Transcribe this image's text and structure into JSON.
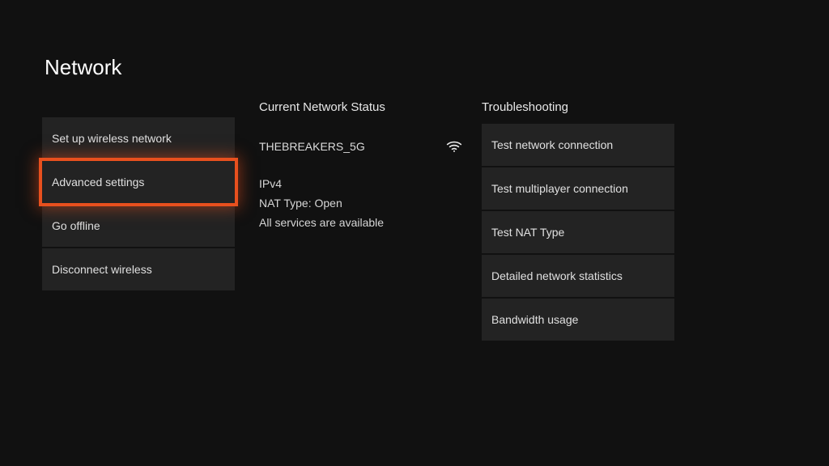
{
  "title": "Network",
  "left": {
    "items": [
      {
        "label": "Set up wireless network",
        "selected": false
      },
      {
        "label": "Advanced settings",
        "selected": true
      },
      {
        "label": "Go offline",
        "selected": false
      },
      {
        "label": "Disconnect wireless",
        "selected": false
      }
    ]
  },
  "status": {
    "heading": "Current Network Status",
    "ssid": "THEBREAKERS_5G",
    "ip_version": "IPv4",
    "nat": "NAT Type: Open",
    "services": "All services are available"
  },
  "troubleshooting": {
    "heading": "Troubleshooting",
    "items": [
      {
        "label": "Test network connection"
      },
      {
        "label": "Test multiplayer connection"
      },
      {
        "label": "Test NAT Type"
      },
      {
        "label": "Detailed network statistics"
      },
      {
        "label": "Bandwidth usage"
      }
    ]
  }
}
